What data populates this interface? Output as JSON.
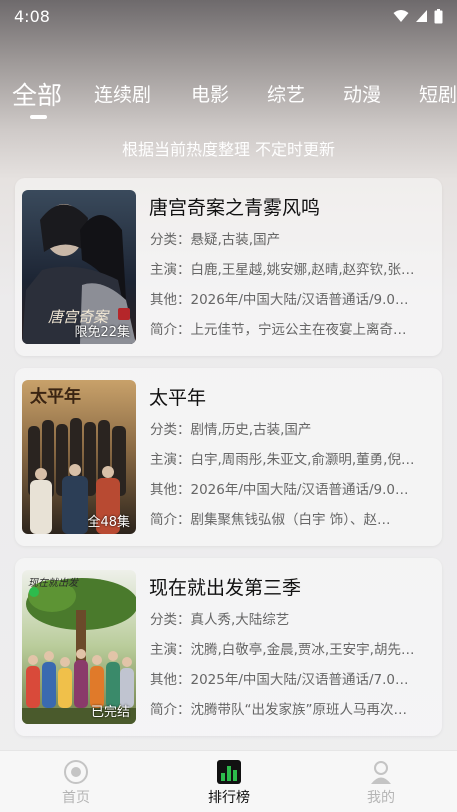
{
  "status_bar": {
    "time": "4:08"
  },
  "tabs": [
    {
      "label": "全部",
      "active": true
    },
    {
      "label": "连续剧"
    },
    {
      "label": "电影"
    },
    {
      "label": "综艺"
    },
    {
      "label": "动漫"
    },
    {
      "label": "短剧"
    }
  ],
  "subtitle": "根据当前热度整理 不定时更新",
  "items": [
    {
      "title": "唐宫奇案之青雾风鸣",
      "badge": "限免22集",
      "genre": "分类：悬疑,古装,国产",
      "cast": "主演：白鹿,王星越,姚安娜,赵晴,赵弈钦,张…",
      "other": "其他：2026年/中国大陆/汉语普通话/9.0…",
      "summary": "简介：上元佳节，宁远公主在夜宴上离奇…"
    },
    {
      "title": "太平年",
      "badge": "全48集",
      "genre": "分类：剧情,历史,古装,国产",
      "cast": "主演：白宇,周雨彤,朱亚文,俞灏明,董勇,倪…",
      "other": "其他：2026年/中国大陆/汉语普通话/9.0…",
      "summary": "简介：剧集聚焦钱弘俶（白宇 饰）、赵…"
    },
    {
      "title": "现在就出发第三季",
      "badge": "已完结",
      "genre": "分类：真人秀,大陆综艺",
      "cast": "主演：沈腾,白敬亭,金晨,贾冰,王安宇,胡先…",
      "other": "其他：2025年/中国大陆/汉语普通话/7.0…",
      "summary": "简介：沈腾带队“出发家族”原班人马再次…"
    }
  ],
  "bottom_nav": [
    {
      "label": "首页",
      "icon": "home-icon"
    },
    {
      "label": "排行榜",
      "icon": "ranking-icon",
      "active": true
    },
    {
      "label": "我的",
      "icon": "profile-icon"
    }
  ],
  "colors": {
    "accent": "#2dbb4c",
    "inactive": "#b5b5b5"
  }
}
